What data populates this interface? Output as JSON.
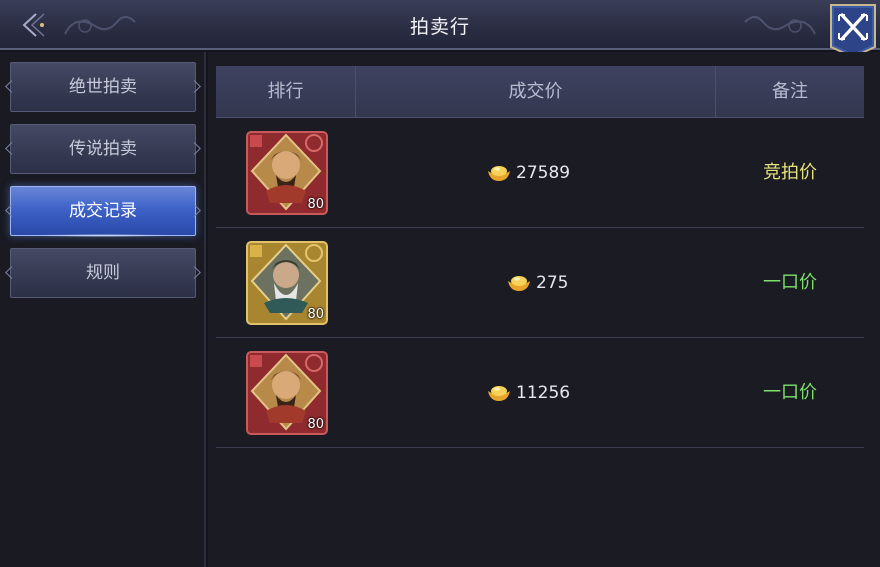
{
  "header": {
    "title": "拍卖行"
  },
  "sidebar": {
    "tabs": [
      {
        "label": "绝世拍卖",
        "active": false
      },
      {
        "label": "传说拍卖",
        "active": false
      },
      {
        "label": "成交记录",
        "active": true
      },
      {
        "label": "规则",
        "active": false
      }
    ]
  },
  "table": {
    "columns": [
      "排行",
      "成交价",
      "备注"
    ],
    "rows": [
      {
        "item_level": "80",
        "item_frame": "red",
        "price": "27589",
        "note": "竞拍价",
        "note_color": "#e6e17a"
      },
      {
        "item_level": "80",
        "item_frame": "gold",
        "price": "275",
        "note": "一口价",
        "note_color": "#7ee06a"
      },
      {
        "item_level": "80",
        "item_frame": "red",
        "price": "11256",
        "note": "一口价",
        "note_color": "#7ee06a"
      }
    ]
  },
  "colors": {
    "active_tab": "#3e62c8",
    "bid_price_note": "#e6e17a",
    "fixed_price_note": "#7ee06a"
  },
  "icons": {
    "currency": "gold-ingot-icon",
    "back": "back-arrow-icon",
    "close": "close-x-icon"
  }
}
